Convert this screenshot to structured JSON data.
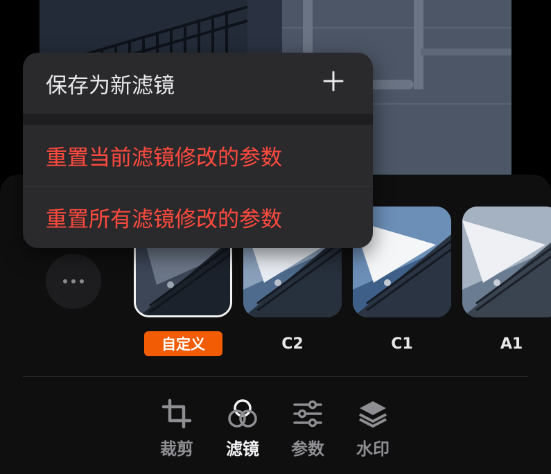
{
  "menu": {
    "items": [
      {
        "label": "保存为新滤镜",
        "icon": "plus-icon"
      },
      {
        "label": "重置当前滤镜修改的参数"
      },
      {
        "label": "重置所有滤镜修改的参数"
      }
    ],
    "destructive_color": "#ff4a3d"
  },
  "filters": {
    "more_icon": "more-dots-icon",
    "items": [
      {
        "label": "自定义",
        "selected": true
      },
      {
        "label": "C2",
        "selected": false
      },
      {
        "label": "C1",
        "selected": false
      },
      {
        "label": "A1",
        "selected": false
      }
    ],
    "accent_color": "#f25c05"
  },
  "tabbar": {
    "tabs": [
      {
        "label": "裁剪",
        "icon": "crop-icon",
        "active": false
      },
      {
        "label": "滤镜",
        "icon": "filter-circles-icon",
        "active": true
      },
      {
        "label": "参数",
        "icon": "sliders-icon",
        "active": false
      },
      {
        "label": "水印",
        "icon": "layers-icon",
        "active": false
      }
    ]
  }
}
